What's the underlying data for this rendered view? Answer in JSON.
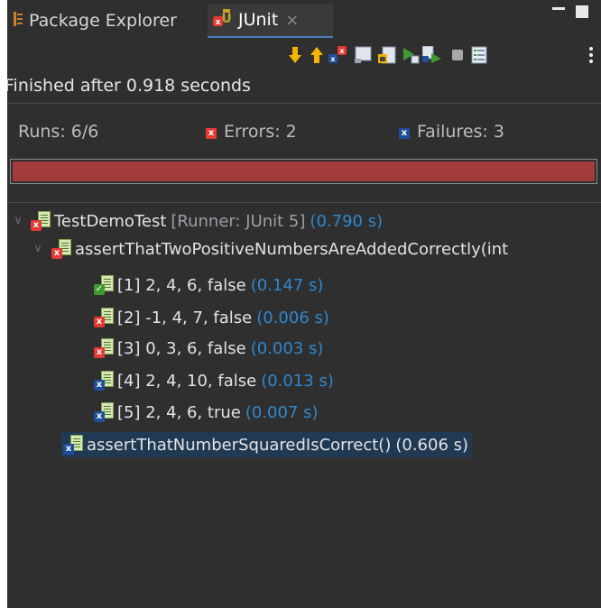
{
  "tabs": {
    "package_explorer": "Package Explorer",
    "junit": "JUnit",
    "close_glyph": "×"
  },
  "toolbar": {
    "icons": [
      "next-failure-icon",
      "previous-failure-icon",
      "show-failures-only-icon",
      "scroll-lock-icon",
      "show-skipped-icon",
      "rerun-icon",
      "rerun-failed-first-icon",
      "stop-icon",
      "test-run-history-icon",
      "view-menu-icon"
    ]
  },
  "status": {
    "text": "Finished after 0.918 seconds"
  },
  "counters": {
    "runs": "Runs: 6/6",
    "errors": "Errors: 2",
    "failures": "Failures: 3"
  },
  "progress": {
    "fraction": 1.0,
    "color": "#a33a3b"
  },
  "tree": {
    "root": {
      "name": "TestDemoTest",
      "runner": "[Runner: JUnit 5]",
      "time": "(0.790 s)",
      "status": "error"
    },
    "method1": {
      "name": "assertThatTwoPositiveNumbersAreAddedCorrectly(int",
      "status": "error"
    },
    "cases": [
      {
        "label": "[1] 2, 4, 6, false",
        "time": "(0.147 s)",
        "status": "ok"
      },
      {
        "label": "[2] -1, 4, 7, false",
        "time": "(0.006 s)",
        "status": "error"
      },
      {
        "label": "[3] 0, 3, 6, false",
        "time": "(0.003 s)",
        "status": "error"
      },
      {
        "label": "[4] 2, 4, 10, false",
        "time": "(0.013 s)",
        "status": "failure"
      },
      {
        "label": "[5] 2, 4, 6, true",
        "time": "(0.007 s)",
        "status": "failure"
      }
    ],
    "method2": {
      "name": "assertThatNumberSquaredIsCorrect()",
      "time": "(0.606 s)",
      "status": "failure",
      "selected": true
    }
  },
  "colors": {
    "error": "#e53935",
    "failure": "#1f4f9a",
    "ok": "#3f9b2f",
    "time": "#2e88cf",
    "selection": "#213a54"
  }
}
